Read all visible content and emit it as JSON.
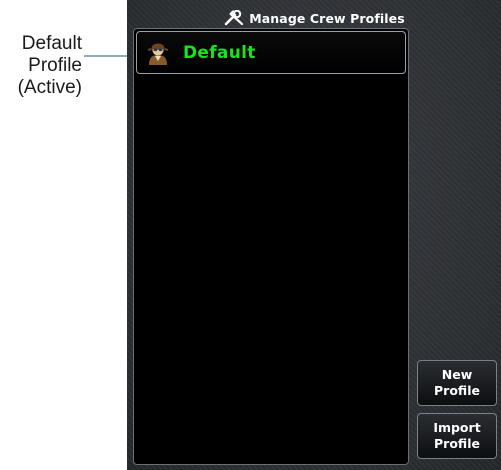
{
  "annotation": {
    "lines": [
      "Default",
      "Profile",
      "(Active)"
    ]
  },
  "header": {
    "title": "Manage Crew Profiles",
    "icon": "wrench-screwdriver-icon"
  },
  "profiles": [
    {
      "label": "Default",
      "active": true,
      "icon": "pilot-avatar-icon",
      "color": "#18e41e"
    }
  ],
  "buttons": {
    "new_profile": [
      "New",
      "Profile"
    ],
    "import_profile": [
      "Import",
      "Profile"
    ]
  }
}
